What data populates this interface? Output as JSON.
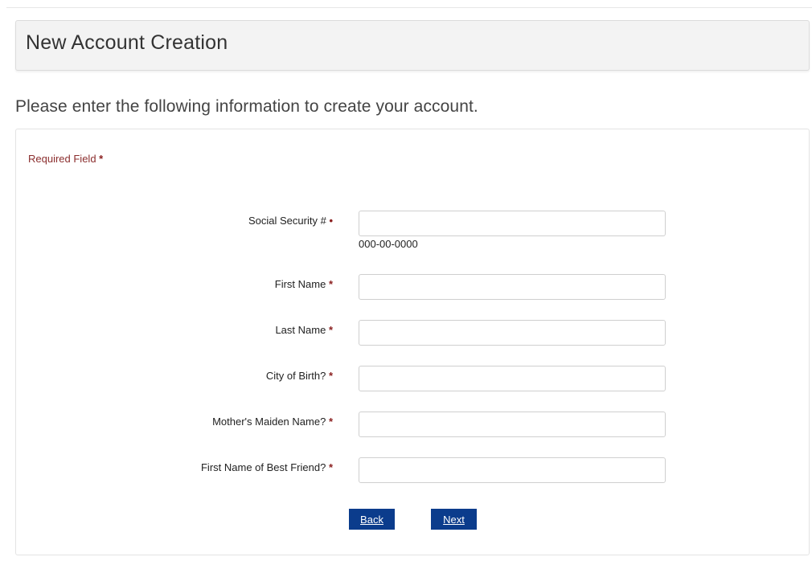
{
  "header": {
    "title": "New Account Creation"
  },
  "intro": "Please enter the following information to create your account.",
  "form": {
    "required_note": "Required Field",
    "required_marker": "*",
    "ssn": {
      "label": "Social Security #",
      "marker": "•",
      "value": "",
      "hint": "000-00-0000"
    },
    "first_name": {
      "label": "First Name",
      "value": ""
    },
    "last_name": {
      "label": "Last Name",
      "value": ""
    },
    "city_of_birth": {
      "label": "City of Birth?",
      "value": ""
    },
    "mothers_maiden_name": {
      "label": "Mother's Maiden Name?",
      "value": ""
    },
    "best_friend": {
      "label": "First Name of Best Friend?",
      "value": ""
    }
  },
  "buttons": {
    "back": "Back",
    "next": "Next"
  },
  "colors": {
    "button_bg": "#0b3c8c",
    "required": "#8b2020"
  }
}
